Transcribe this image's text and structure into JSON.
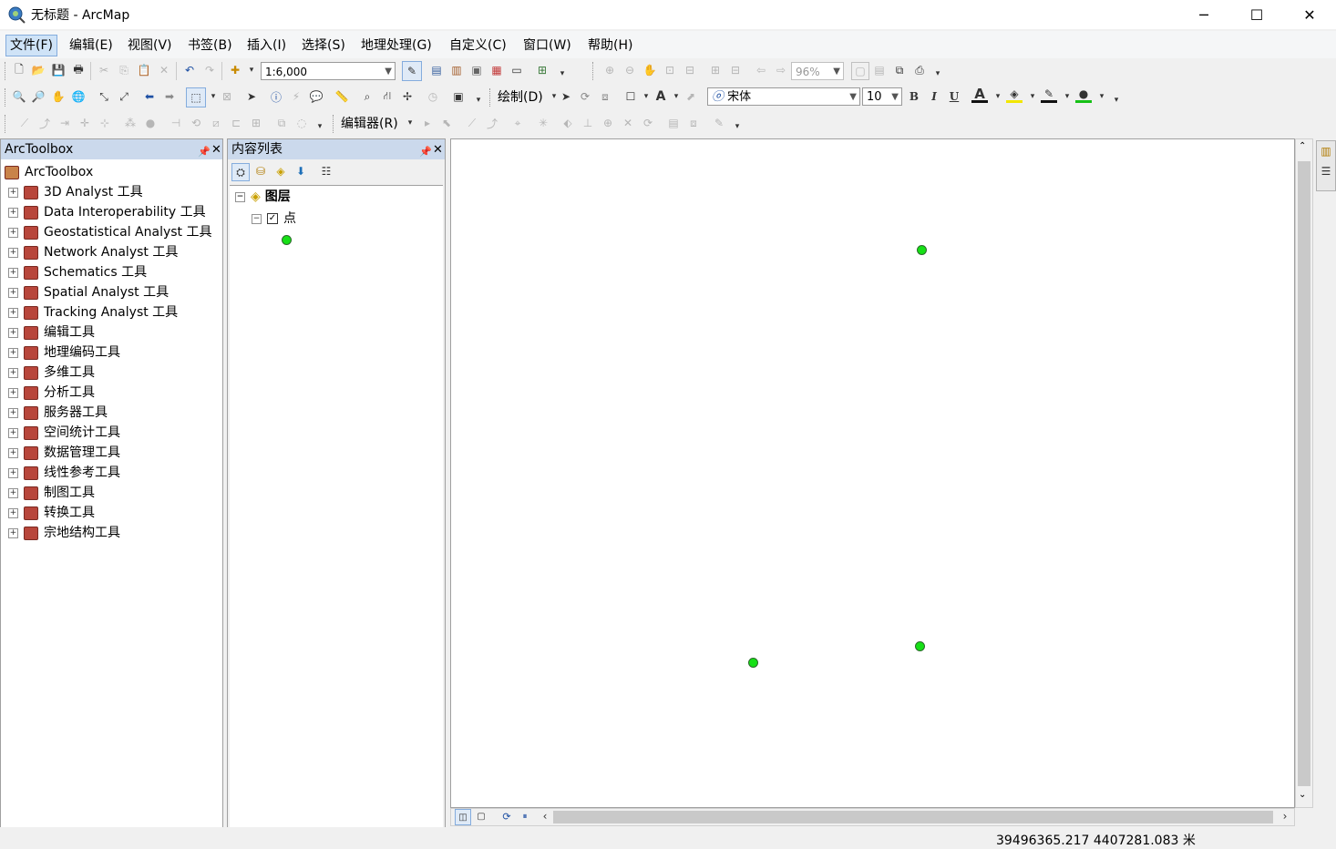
{
  "window": {
    "title": "无标题 - ArcMap",
    "min": "─",
    "max": "☐",
    "close": "✕"
  },
  "menu": [
    "文件(F)",
    "编辑(E)",
    "视图(V)",
    "书签(B)",
    "插入(I)",
    "选择(S)",
    "地理处理(G)",
    "自定义(C)",
    "窗口(W)",
    "帮助(H)"
  ],
  "toolbar": {
    "scale": "1:6,000",
    "zoom": "96%",
    "draw_label": "绘制(D)",
    "font": "宋体",
    "font_size": "10",
    "bold": "B",
    "italic": "I",
    "underline": "U",
    "font_color_glyph": "A",
    "editor_label": "编辑器(R)"
  },
  "toolbox": {
    "title": "ArcToolbox",
    "root": "ArcToolbox",
    "items": [
      "3D Analyst 工具",
      "Data Interoperability 工具",
      "Geostatistical Analyst 工具",
      "Network Analyst 工具",
      "Schematics 工具",
      "Spatial Analyst 工具",
      "Tracking Analyst 工具",
      "编辑工具",
      "地理编码工具",
      "多维工具",
      "分析工具",
      "服务器工具",
      "空间统计工具",
      "数据管理工具",
      "线性参考工具",
      "制图工具",
      "转换工具",
      "宗地结构工具"
    ]
  },
  "toc": {
    "title": "内容列表",
    "group": "图层",
    "layer": "点"
  },
  "map": {
    "point_color": "#16e016",
    "points_count_visible": 3
  },
  "status": {
    "coords": "39496365.217  4407281.083 米"
  }
}
